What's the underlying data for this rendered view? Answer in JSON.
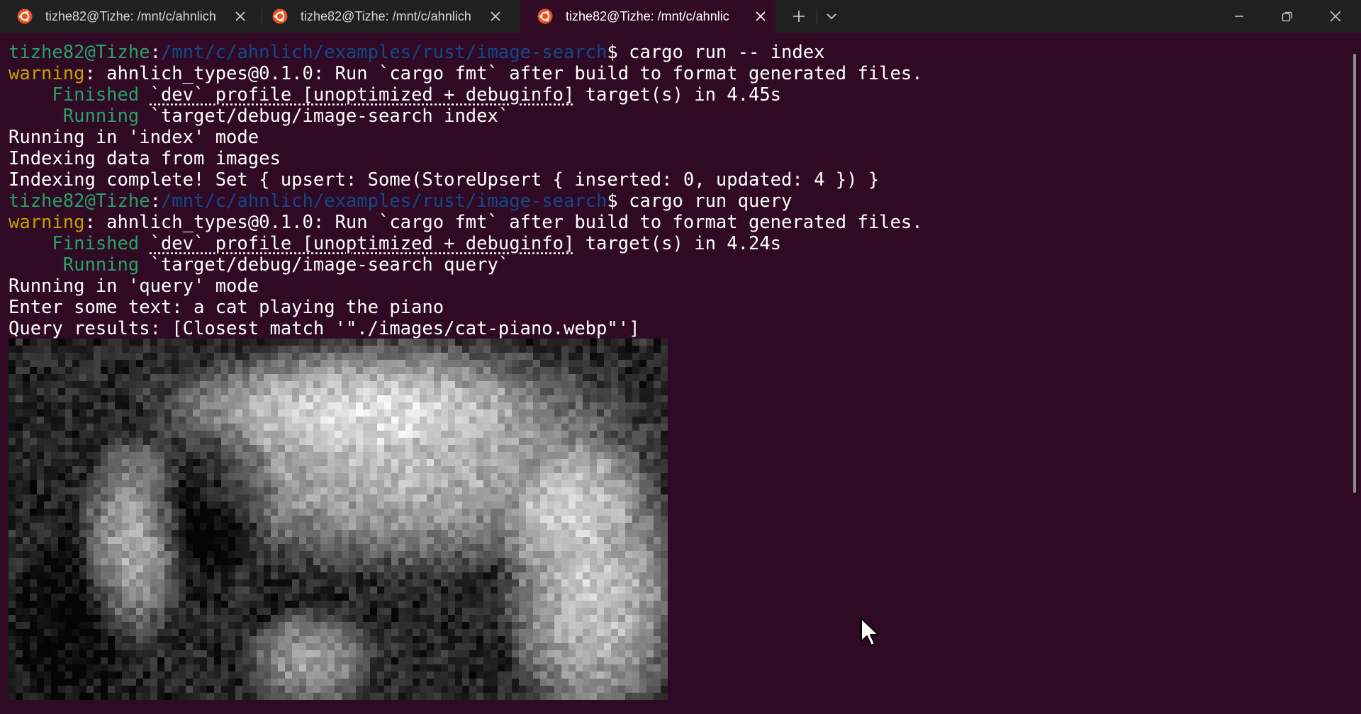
{
  "tabs": [
    {
      "title": "tizhe82@Tizhe: /mnt/c/ahnlich"
    },
    {
      "title": "tizhe82@Tizhe: /mnt/c/ahnlich"
    },
    {
      "title": "tizhe82@Tizhe: /mnt/c/ahnlic"
    }
  ],
  "icons": {
    "tab": "ubuntu-icon",
    "close": "close-icon",
    "new_tab": "plus-icon",
    "dropdown": "chevron-down-icon",
    "minimize": "minimize-icon",
    "restore": "restore-icon",
    "window_close": "close-icon"
  },
  "colors": {
    "background": "#300a24",
    "tabbar": "#202020",
    "user_host": "#26a269",
    "path": "#12488b",
    "warning": "#c4a000",
    "status": "#26a269"
  },
  "terminal": {
    "prompt_user": "tizhe82@Tizhe",
    "prompt_sep": ":",
    "prompt_path": "/mnt/c/ahnlich/examples/rust/image-search",
    "prompt_dollar": "$",
    "cmd1": " cargo run -- index",
    "warning_word": "warning",
    "warning_rest": ": ahnlich_types@0.1.0: Run `cargo fmt` after build to format generated files.",
    "finished_word": "    Finished",
    "profile": "`dev` profile [unoptimized + debuginfo]",
    "finished_rest1": " target(s) in 4.45s",
    "running_word": "     Running",
    "running_rest1": " `target/debug/image-search index`",
    "out1": "Running in 'index' mode",
    "out2": "Indexing data from images",
    "out3": "Indexing complete! Set { upsert: Some(StoreUpsert { inserted: 0, updated: 4 }) }",
    "cmd2": " cargo run query",
    "finished_rest2": " target(s) in 4.24s",
    "running_rest2": " `target/debug/image-search query`",
    "out4": "Running in 'query' mode",
    "out5": "Enter some text: a cat playing the piano",
    "out6": "Query results: [Closest match '\"./images/cat-piano.webp\"']"
  }
}
